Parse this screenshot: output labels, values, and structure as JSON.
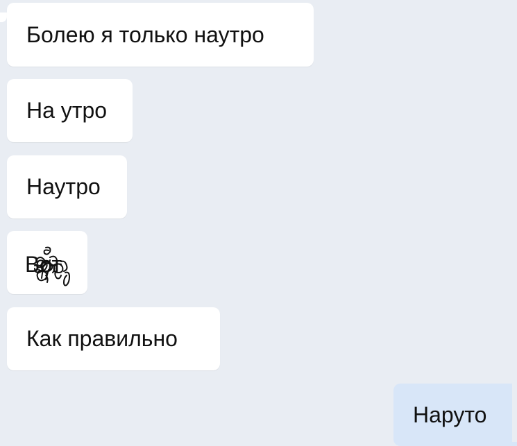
{
  "messages": [
    {
      "direction": "incoming",
      "text": "Болею я только наутро"
    },
    {
      "direction": "incoming",
      "text": "На утро"
    },
    {
      "direction": "incoming",
      "text": "Наутро"
    },
    {
      "direction": "incoming",
      "text": "Вот",
      "scribbled": true
    },
    {
      "direction": "incoming",
      "text": "Как правильно"
    },
    {
      "direction": "outgoing",
      "text": "Наруто"
    }
  ],
  "colors": {
    "background": "#e9edf3",
    "incoming_bubble": "#ffffff",
    "outgoing_bubble": "#d8e6f8",
    "text": "#111111"
  }
}
